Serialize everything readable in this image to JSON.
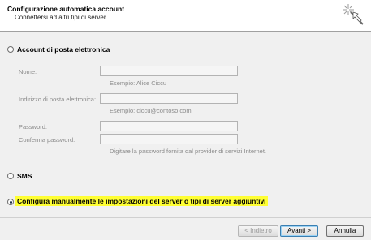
{
  "header": {
    "title": "Configurazione automatica account",
    "subtitle": "Connettersi ad altri tipi di server."
  },
  "email_account": {
    "label": "Account di posta elettronica",
    "name_label": "Nome:",
    "name_value": "",
    "name_hint": "Esempio: Alice Ciccu",
    "email_label": "Indirizzo di posta elettronica:",
    "email_value": "",
    "email_hint": "Esempio: ciccu@contoso.com",
    "password_label": "Password:",
    "confirm_label": "Conferma password:",
    "password_hint": "Digitare la password fornita dal provider di servizi Internet."
  },
  "sms": {
    "label": "SMS"
  },
  "manual": {
    "label": "Configura manualmente le impostazioni del server o tipi di server aggiuntivi"
  },
  "buttons": {
    "back": "< Indietro",
    "next": "Avanti >",
    "cancel": "Annulla"
  },
  "colors": {
    "highlight": "#ffff33"
  }
}
